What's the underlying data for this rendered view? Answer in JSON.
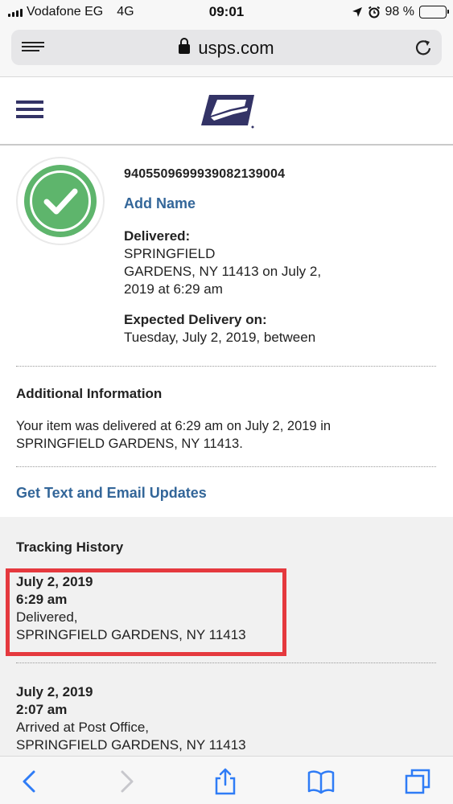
{
  "status_bar": {
    "carrier": "Vodafone EG",
    "network": "4G",
    "time": "09:01",
    "battery": "98 %",
    "battery_level": 0.98
  },
  "browser": {
    "url": "usps.com"
  },
  "tracking": {
    "number": "9405509699939082139004",
    "add_name": "Add Name",
    "status_heading": "Delivered:",
    "status_lines": [
      "SPRINGFIELD",
      "GARDENS, NY 11413 on July 2,",
      "2019 at 6:29 am"
    ],
    "expected_heading": "Expected Delivery on:",
    "expected_text": "Tuesday, July 2, 2019, between"
  },
  "additional": {
    "title": "Additional Information",
    "lines": [
      "Your item was delivered at 6:29 am on July 2, 2019 in",
      "SPRINGFIELD GARDENS, NY 11413."
    ]
  },
  "updates_link": "Get Text and Email Updates",
  "history": {
    "title": "Tracking History",
    "events": [
      {
        "date": "July 2, 2019",
        "time": "6:29 am",
        "status": "Delivered,",
        "location": "SPRINGFIELD GARDENS, NY 11413"
      },
      {
        "date": "July 2, 2019",
        "time": "2:07 am",
        "status": "Arrived at Post Office,",
        "location": "SPRINGFIELD GARDENS, NY 11413"
      }
    ]
  },
  "colors": {
    "link": "#336699",
    "success": "#5eb56c",
    "usps_navy": "#333366",
    "highlight": "#e5393e"
  },
  "icons": {
    "reader": "reader-view-icon",
    "lock": "lock-icon",
    "reload": "reload-icon",
    "menu": "hamburger-menu-icon",
    "logo": "usps-eagle-logo",
    "check": "check-icon",
    "back": "back-arrow-icon",
    "forward": "forward-arrow-icon",
    "share": "share-icon",
    "bookmarks": "bookmarks-icon",
    "tabs": "tabs-icon"
  }
}
